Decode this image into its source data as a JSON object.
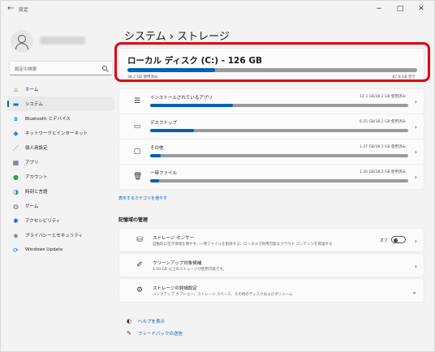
{
  "window": {
    "app_title": "設定",
    "back_glyph": "←",
    "min_glyph": "−",
    "max_glyph": "□",
    "close_glyph": "✕"
  },
  "sidebar": {
    "search_placeholder": "設定の検索",
    "items": [
      {
        "label": "ホーム",
        "icon": "home-icon",
        "glyph": "⌂",
        "color": "#d9822b"
      },
      {
        "label": "システム",
        "icon": "system-icon",
        "glyph": "▬",
        "color": "#1b6fc4",
        "active": true
      },
      {
        "label": "Bluetooth とデバイス",
        "icon": "bluetooth-icon",
        "glyph": "ʙ",
        "color": "#0067c0"
      },
      {
        "label": "ネットワークとインターネット",
        "icon": "network-icon",
        "glyph": "◆",
        "color": "#3b7dd8"
      },
      {
        "label": "個人用設定",
        "icon": "personalization-icon",
        "glyph": "／",
        "color": "#b65a1e"
      },
      {
        "label": "アプリ",
        "icon": "apps-icon",
        "glyph": "▦",
        "color": "#4a5b7a"
      },
      {
        "label": "アカウント",
        "icon": "accounts-icon",
        "glyph": "●",
        "color": "#2e9a5a"
      },
      {
        "label": "時刻と言語",
        "icon": "time-language-icon",
        "glyph": "◑",
        "color": "#2a86c8"
      },
      {
        "label": "ゲーム",
        "icon": "gaming-icon",
        "glyph": "◍",
        "color": "#6a6a6a"
      },
      {
        "label": "アクセシビリティ",
        "icon": "accessibility-icon",
        "glyph": "✱",
        "color": "#1e5aa8"
      },
      {
        "label": "プライバシーとセキュリティ",
        "icon": "privacy-icon",
        "glyph": "◈",
        "color": "#6b6b6b"
      },
      {
        "label": "Windows Update",
        "icon": "windows-update-icon",
        "glyph": "⟳",
        "color": "#0a6cce"
      }
    ]
  },
  "main": {
    "breadcrumb": "システム  ›  ストレージ",
    "drive": {
      "title": "ローカル ディスク (C:) - 126 GB",
      "used_text": "38.2 GB 使用済み",
      "free_text": "87.9 GB 空き",
      "used_fraction": 0.303
    },
    "categories": [
      {
        "label": "インストールされているアプリ",
        "value": "12.3 GB/38.2 GB 使用済み",
        "icon": "apps-list-icon",
        "glyph": "☰",
        "fraction": 0.32
      },
      {
        "label": "デスクトップ",
        "value": "6.55 GB/38.2 GB 使用済み",
        "icon": "desktop-icon",
        "glyph": "▭",
        "fraction": 0.17
      },
      {
        "label": "その他",
        "value": "1.47 GB/38.2 GB 使用済み",
        "icon": "other-files-icon",
        "glyph": "▢",
        "fraction": 0.04
      },
      {
        "label": "一時ファイル",
        "value": "1.36 GB/38.2 GB 使用済み",
        "icon": "trash-icon",
        "glyph": "🗑",
        "fraction": 0.035
      }
    ],
    "more_categories_link": "表示するカテゴリを増やす",
    "management_title": "記憶域の管理",
    "settings": [
      {
        "title": "ストレージ センサー",
        "desc": "自動的に空き領域を増やす、一時ファイルを削除する、ローカルで利用可能なクラウド コンテンツを管理する",
        "icon": "storage-sense-icon",
        "glyph": "⛁",
        "toggle_label": "オフ",
        "chevron": "›"
      },
      {
        "title": "クリーンアップ対象候補",
        "desc": "1.00 GB 以上のストレージが使用可能です。",
        "icon": "cleanup-icon",
        "glyph": "✐",
        "chevron": "›"
      },
      {
        "title": "ストレージの詳細設定",
        "desc": "バックアップ オプション、ストレージ スペース、その他のディスクおよびボリューム",
        "icon": "advanced-storage-icon",
        "glyph": "⚙",
        "chevron": "⌄"
      }
    ],
    "help_link": "ヘルプを表示",
    "feedback_link": "フィードバックの送信"
  },
  "colors": {
    "accent": "#005fb8",
    "highlight": "#e0000f",
    "bar_track": "#9a9a9a"
  }
}
